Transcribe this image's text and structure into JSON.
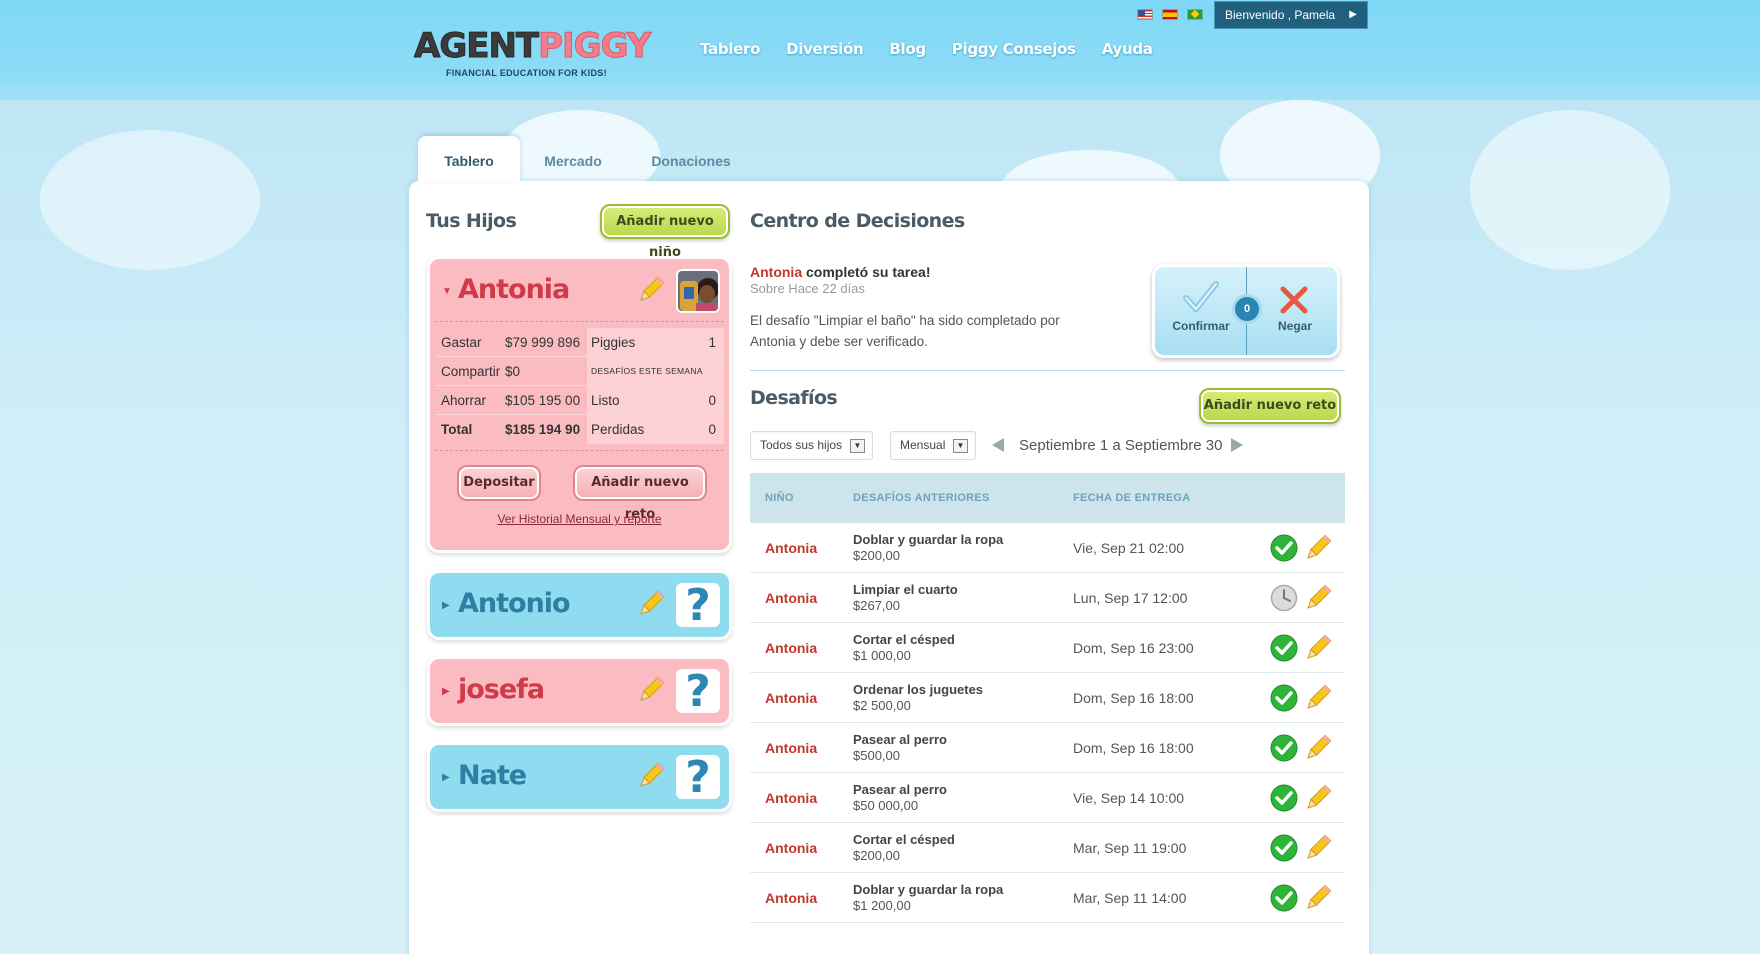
{
  "header": {
    "logo_part1": "AGENT",
    "logo_part2": "PIGGY",
    "logo_tagline": "FINANCIAL EDUCATION FOR KIDS!",
    "nav": [
      "Tablero",
      "Diversión",
      "Blog",
      "Piggy Consejos",
      "Ayuda"
    ],
    "welcome": "Bienvenido , Pamela"
  },
  "tabs": [
    "Tablero",
    "Mercado",
    "Donaciones"
  ],
  "kids_panel": {
    "title": "Tus Hijos",
    "add_kid_button": "Añadir nuevo niño",
    "expanded": {
      "name": "Antonia",
      "stats": [
        {
          "label": "Gastar",
          "value": "$79 999 896",
          "right_label": "Piggies",
          "right_value": "1"
        },
        {
          "label": "Compartir",
          "value": "$0",
          "right_label": "DESAFÍOS ESTE SEMANA",
          "right_value": ""
        },
        {
          "label": "Ahorrar",
          "value": "$105 195 00",
          "right_label": "Listo",
          "right_value": "0"
        },
        {
          "label": "Total",
          "value": "$185 194 90",
          "right_label": "Perdidas",
          "right_value": "0"
        }
      ],
      "deposit_button": "Depositar",
      "add_challenge_button": "Añadir nuevo reto",
      "history_link": "Ver Historial Mensual y reporte"
    },
    "collapsed": [
      {
        "name": "Antonio",
        "color": "blue"
      },
      {
        "name": "josefa",
        "color": "pink"
      },
      {
        "name": "Nate",
        "color": "blue"
      }
    ]
  },
  "decision_center": {
    "title": "Centro de Decisiones",
    "kid_name": "Antonia",
    "action_text": " completó su tarea!",
    "time": "Sobre Hace 22 días",
    "message": "El desafío \"Limpiar el baño\" ha sido completado por Antonia y debe ser verificado.",
    "confirm_label": "Confirmar",
    "deny_label": "Negar",
    "coin_value": "0"
  },
  "challenges": {
    "title": "Desafíos",
    "add_button": "Añadir nuevo reto",
    "filter_kids": "Todos sus hijos",
    "filter_period": "Mensual",
    "date_range": "Septiembre 1 a Septiembre 30",
    "columns": [
      "NIÑO",
      "DESAFÍOS ANTERIORES",
      "FECHA DE ENTREGA"
    ],
    "rows": [
      {
        "kid": "Antonia",
        "task": "Doblar y guardar la ropa",
        "amount": "$200,00",
        "due": "Vie, Sep 21 02:00",
        "status": "done"
      },
      {
        "kid": "Antonia",
        "task": "Limpiar el cuarto",
        "amount": "$267,00",
        "due": "Lun, Sep 17 12:00",
        "status": "pending"
      },
      {
        "kid": "Antonia",
        "task": "Cortar el césped",
        "amount": "$1 000,00",
        "due": "Dom, Sep 16 23:00",
        "status": "done"
      },
      {
        "kid": "Antonia",
        "task": "Ordenar los juguetes",
        "amount": "$2 500,00",
        "due": "Dom, Sep 16 18:00",
        "status": "done"
      },
      {
        "kid": "Antonia",
        "task": "Pasear al perro",
        "amount": "$500,00",
        "due": "Dom, Sep 16 18:00",
        "status": "done"
      },
      {
        "kid": "Antonia",
        "task": "Pasear al perro",
        "amount": "$50 000,00",
        "due": "Vie, Sep 14 10:00",
        "status": "done"
      },
      {
        "kid": "Antonia",
        "task": "Cortar el césped",
        "amount": "$200,00",
        "due": "Mar, Sep 11 19:00",
        "status": "done"
      },
      {
        "kid": "Antonia",
        "task": "Doblar y guardar la ropa",
        "amount": "$1 200,00",
        "due": "Mar, Sep 11 14:00",
        "status": "done"
      }
    ]
  },
  "colors": {
    "sky": "#8edcf7",
    "pink_card": "#fbbcc1",
    "blue_card": "#8fdbf0",
    "green_button": "#c4de5a",
    "kid_name_red": "#c0392b"
  }
}
